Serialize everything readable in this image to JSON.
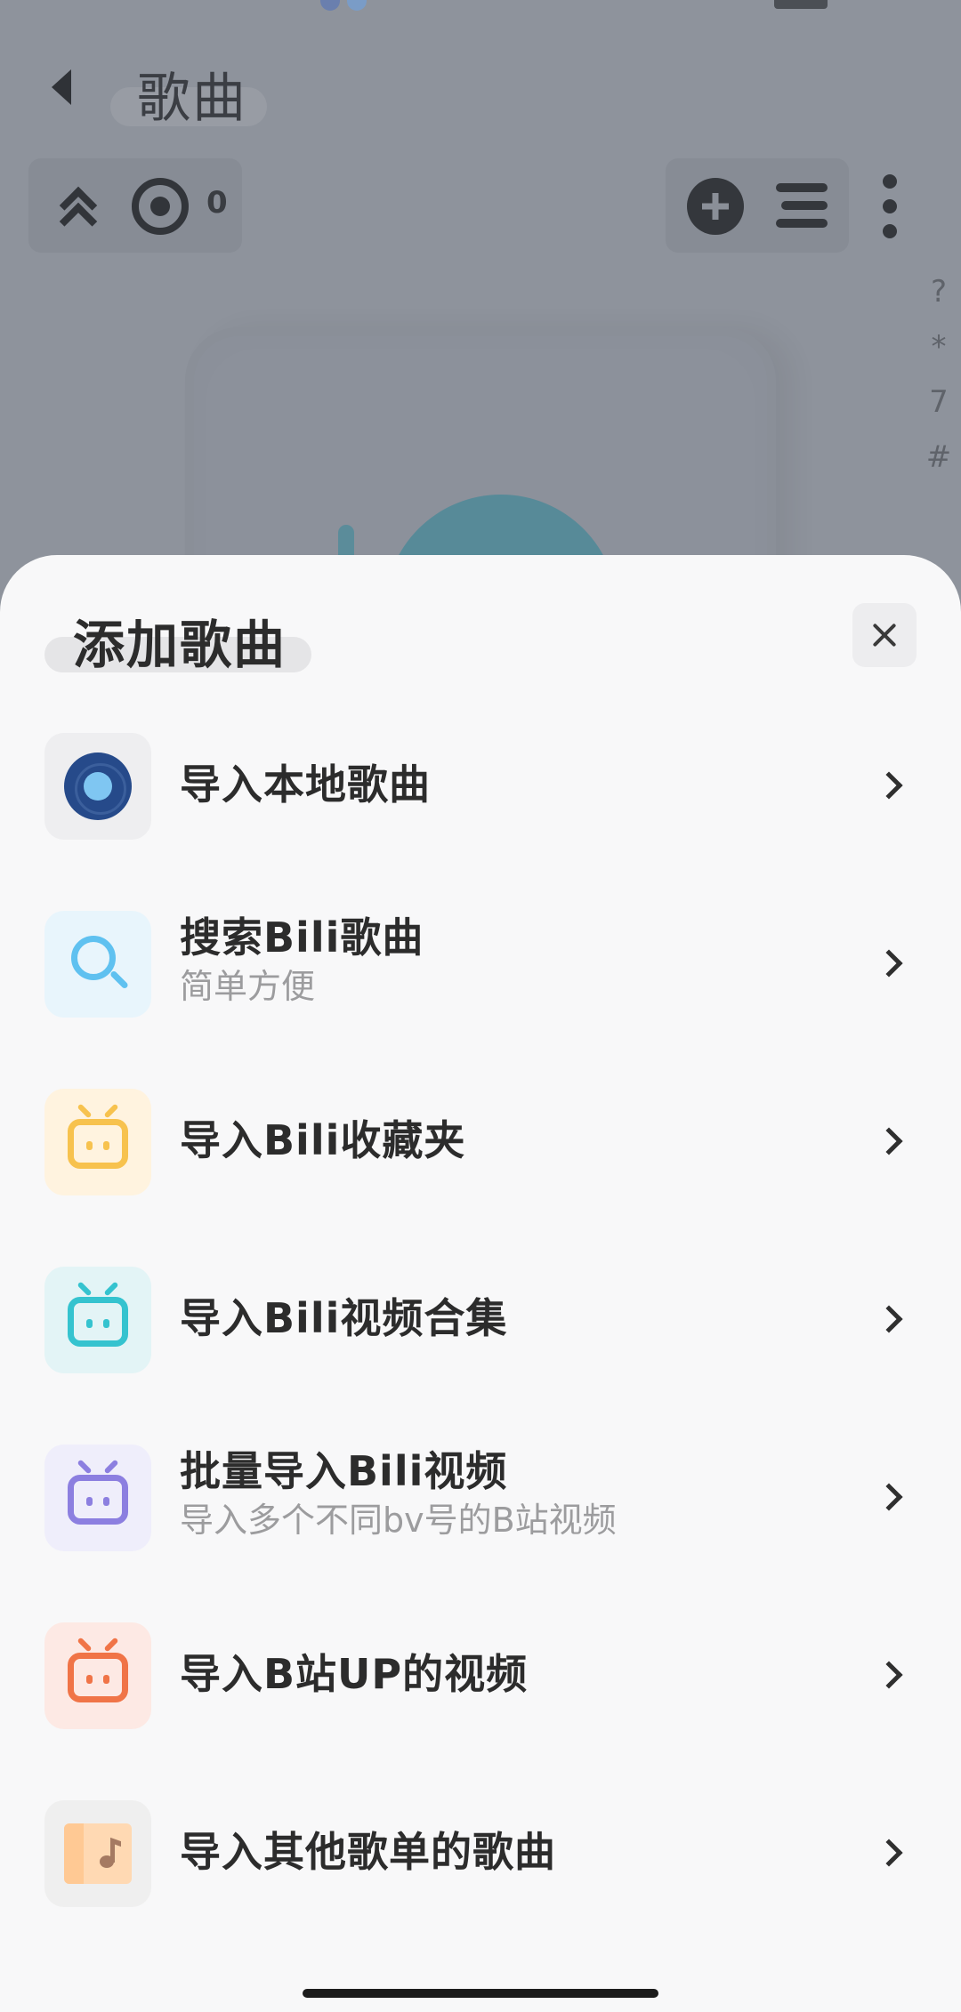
{
  "background_page": {
    "title": "歌曲",
    "locate_count": "0",
    "index_letters": [
      "?",
      "*",
      "7",
      "#"
    ]
  },
  "sheet": {
    "title": "添加歌曲",
    "items": [
      {
        "label": "导入本地歌曲",
        "sub": "",
        "icon": "vinyl-record-icon",
        "icon_bg": "#eeeef0"
      },
      {
        "label": "搜索Bili歌曲",
        "sub": "简单方便",
        "icon": "search-icon",
        "icon_bg": "#e8f5fc"
      },
      {
        "label": "导入Bili收藏夹",
        "sub": "",
        "icon": "bilibili-tv-icon",
        "icon_bg": "#fff3df",
        "icon_color": "#f7c24e"
      },
      {
        "label": "导入Bili视频合集",
        "sub": "",
        "icon": "bilibili-tv-icon",
        "icon_bg": "#e3f4f6",
        "icon_color": "#35c3cf"
      },
      {
        "label": "批量导入Bili视频",
        "sub": "导入多个不同bv号的B站视频",
        "icon": "bilibili-tv-icon",
        "icon_bg": "#efeefb",
        "icon_color": "#8c7fe0"
      },
      {
        "label": "导入B站UP的视频",
        "sub": "",
        "icon": "bilibili-tv-icon",
        "icon_bg": "#fde9e4",
        "icon_color": "#f07447"
      },
      {
        "label": "导入其他歌单的歌曲",
        "sub": "",
        "icon": "music-book-icon",
        "icon_bg": "#efefef"
      }
    ]
  }
}
